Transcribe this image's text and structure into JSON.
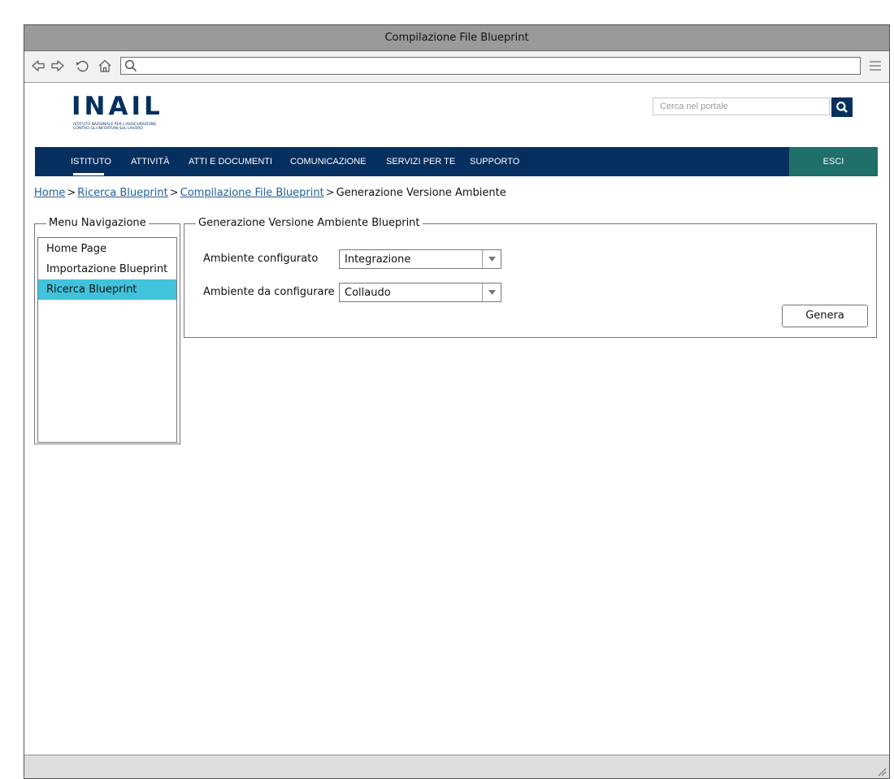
{
  "window": {
    "title": "Compilazione File Blueprint"
  },
  "toolbar": {
    "address_value": "",
    "icons": [
      "back-arrow-icon",
      "forward-arrow-icon",
      "reload-icon",
      "home-icon",
      "search-icon",
      "menu-icon"
    ]
  },
  "header": {
    "logo_text": "INAIL",
    "logo_subtitle_1": "ISTITUTO NAZIONALE PER L'ASSICURAZIONE",
    "logo_subtitle_2": "CONTRO GLI INFORTUNI SUL LAVORO",
    "search_placeholder": "Cerca nel portale"
  },
  "menu": {
    "items": [
      "ISTITUTO",
      "ATTIVITÀ",
      "ATTI E DOCUMENTI",
      "COMUNICAZIONE",
      "SERVIZI PER TE",
      "SUPPORTO"
    ],
    "active": "ISTITUTO",
    "logout_label": "ESCI"
  },
  "breadcrumb": {
    "links": [
      "Home",
      "Ricerca Blueprint",
      "Compilazione File Blueprint"
    ],
    "current": "Generazione Versione Ambiente",
    "separator": ">"
  },
  "sidebar": {
    "legend": "Menu Navigazione",
    "items": [
      "Home Page",
      "Importazione Blueprint",
      "Ricerca Blueprint"
    ],
    "active": "Ricerca Blueprint"
  },
  "form": {
    "legend": "Generazione Versione Ambiente Blueprint",
    "field1_label": "Ambiente configurato",
    "field1_value": "Integrazione",
    "field2_label": "Ambiente da configurare",
    "field2_value": "Collaudo",
    "submit_label": "Genera"
  },
  "colors": {
    "nav_bar": "#052f5f",
    "logout_button": "#1f6f6a",
    "active_nav_item": "#40c3db",
    "link": "#1f5f9a"
  }
}
